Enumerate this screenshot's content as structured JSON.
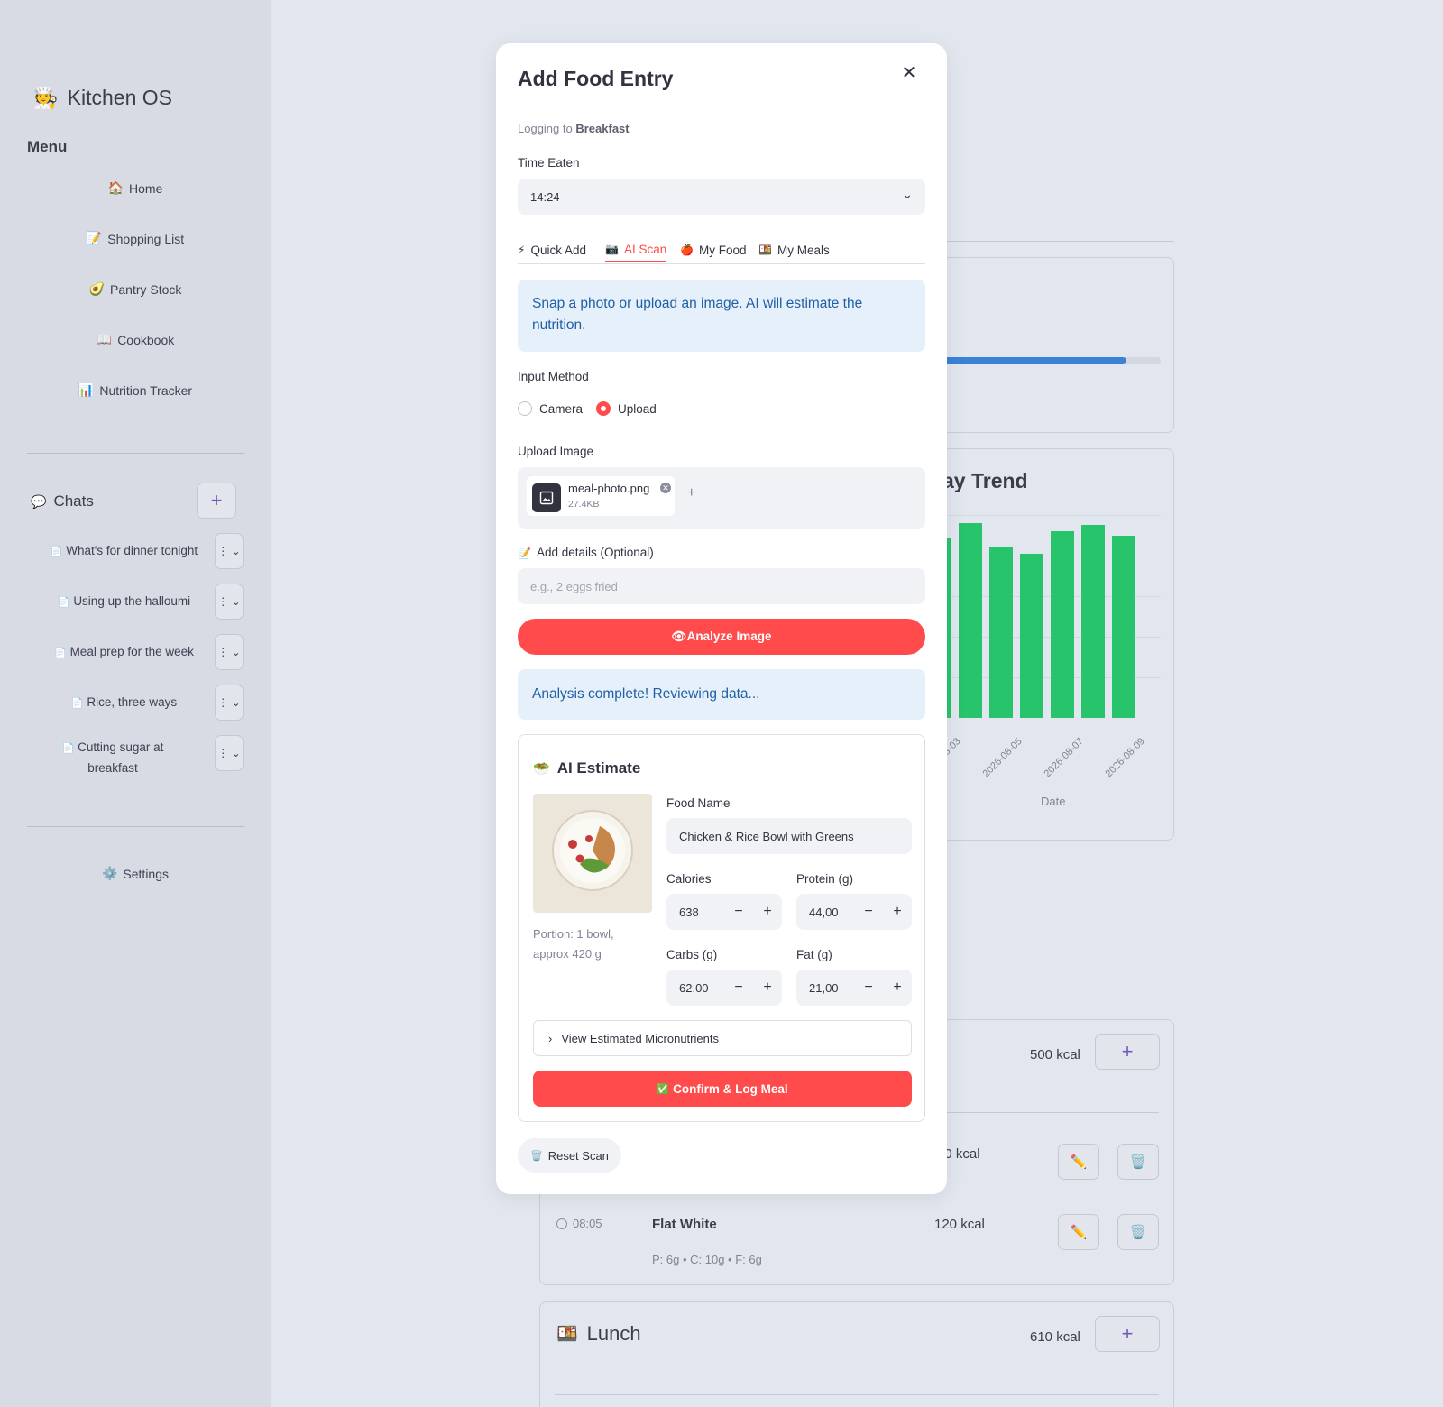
{
  "sidebar": {
    "brand": {
      "icon": "🧑‍🍳",
      "title": "Kitchen OS"
    },
    "menu_title": "Menu",
    "nav": [
      {
        "icon": "🏠",
        "label": "Home"
      },
      {
        "icon": "📝",
        "label": "Shopping List"
      },
      {
        "icon": "🥑",
        "label": "Pantry Stock"
      },
      {
        "icon": "📖",
        "label": "Cookbook"
      },
      {
        "icon": "📊",
        "label": "Nutrition Tracker"
      }
    ],
    "chats_title": {
      "icon": "💬",
      "label": "Chats"
    },
    "new_chat_icon": "+",
    "chats": [
      {
        "icon": "📄",
        "label": "What's for dinner tonight"
      },
      {
        "icon": "📄",
        "label": "Using up the halloumi"
      },
      {
        "icon": "📄",
        "label": "Meal prep for the week"
      },
      {
        "icon": "📄",
        "label": "Rice, three ways"
      },
      {
        "icon": "📄",
        "label": "Cutting sugar at breakfast"
      }
    ],
    "chat_menu_icon": "⋮ ⌄",
    "settings": {
      "icon": "⚙️",
      "label": "Settings"
    }
  },
  "background": {
    "trend_title": "ay Trend",
    "trend_ticks": [
      "08-03",
      "2026-08-05",
      "2026-08-07",
      "2026-08-09"
    ],
    "trend_xlabel": "Date",
    "trend_values": [
      0.885,
      0.96,
      0.84,
      0.81,
      0.92,
      0.95,
      0.9
    ],
    "progress_fraction": 0.85,
    "breakfast_kcal": "500 kcal",
    "hidden_entry_kcal": "30 kcal",
    "entry": {
      "time": "08:05",
      "name": "Flat White",
      "kcal": "120 kcal",
      "macros": "P: 6g • C: 10g • F: 6g"
    },
    "lunch": {
      "icon": "🍱",
      "title": "Lunch",
      "kcal": "610 kcal"
    },
    "add_icon": "+",
    "edit_icon": "✏️",
    "delete_icon": "🗑️"
  },
  "modal": {
    "title": "Add Food Entry",
    "close_icon": "✕",
    "logging_prefix": "Logging to",
    "logging_target": "Breakfast",
    "time_label": "Time Eaten",
    "time_value": "14:24",
    "chevron": "⌄",
    "tabs": [
      {
        "icon": "⚡",
        "label": "Quick Add"
      },
      {
        "icon": "📷",
        "label": "AI Scan"
      },
      {
        "icon": "🍎",
        "label": "My Food"
      },
      {
        "icon": "🍱",
        "label": "My Meals"
      }
    ],
    "scan_info": "Snap a photo or upload an image. AI will estimate the nutrition.",
    "input_method_label": "Input Method",
    "input_methods": [
      "Camera",
      "Upload"
    ],
    "upload_label": "Upload Image",
    "file": {
      "name": "meal-photo.png",
      "size": "27.4KB"
    },
    "add_file_icon": "+",
    "details_icon": "📝",
    "details_label": "Add details (Optional)",
    "details_placeholder": "e.g., 2 eggs fried",
    "analyze_label": "👁Analyze Image",
    "analysis_status": "Analysis complete! Reviewing data...",
    "estimate": {
      "icon": "🥗",
      "title": "AI Estimate",
      "portion": "Portion: 1 bowl, approx 420 g",
      "food_name_label": "Food Name",
      "food_name": "Chicken & Rice Bowl with Greens",
      "calories_label": "Calories",
      "calories": "638",
      "protein_label": "Protein (g)",
      "protein": "44,00",
      "carbs_label": "Carbs (g)",
      "carbs": "62,00",
      "fat_label": "Fat (g)",
      "fat": "21,00",
      "micronutrients_label": "View Estimated Micronutrients",
      "confirm_icon": "✅",
      "confirm_label": "Confirm & Log Meal"
    },
    "reset": {
      "icon": "🗑️",
      "label": "Reset Scan"
    }
  }
}
